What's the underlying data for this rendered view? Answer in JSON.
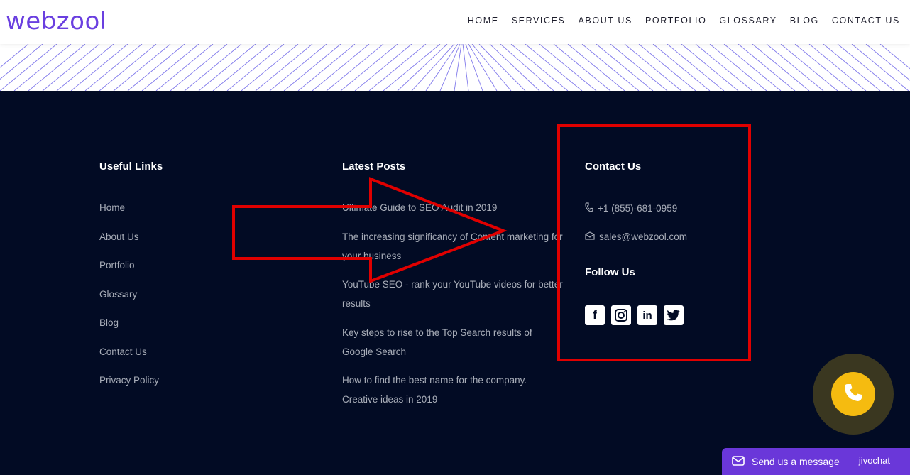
{
  "header": {
    "logo": "webzool",
    "nav": [
      "HOME",
      "SERVICES",
      "ABOUT US",
      "PORTFOLIO",
      "GLOSSARY",
      "BLOG",
      "CONTACT US"
    ]
  },
  "footer": {
    "useful_links": {
      "title": "Useful Links",
      "items": [
        "Home",
        "About Us",
        "Portfolio",
        "Glossary",
        "Blog",
        "Contact Us",
        "Privacy Policy"
      ]
    },
    "latest_posts": {
      "title": "Latest Posts",
      "items": [
        "Ultimate Guide to SEO Audit in 2019",
        "The increasing significancy of Content marketing for your business",
        "YouTube SEO - rank your YouTube videos for better results",
        "Key steps to rise to the Top Search results of Google Search",
        "How to find the best name for the company. Creative ideas in 2019"
      ]
    },
    "contact": {
      "title": "Contact Us",
      "phone": "+1 (855)-681-0959",
      "email": "sales@webzool.com",
      "follow_title": "Follow Us",
      "social": [
        "facebook-icon",
        "instagram-icon",
        "linkedin-icon",
        "twitter-icon"
      ]
    }
  },
  "chat": {
    "label": "Send us a message",
    "brand": "jivochat"
  },
  "colors": {
    "brand": "#6a3fe0",
    "footer_bg": "#020b24",
    "highlight": "#e00000",
    "call_button": "#f5bb10",
    "chat_bar": "#6a37d9"
  }
}
